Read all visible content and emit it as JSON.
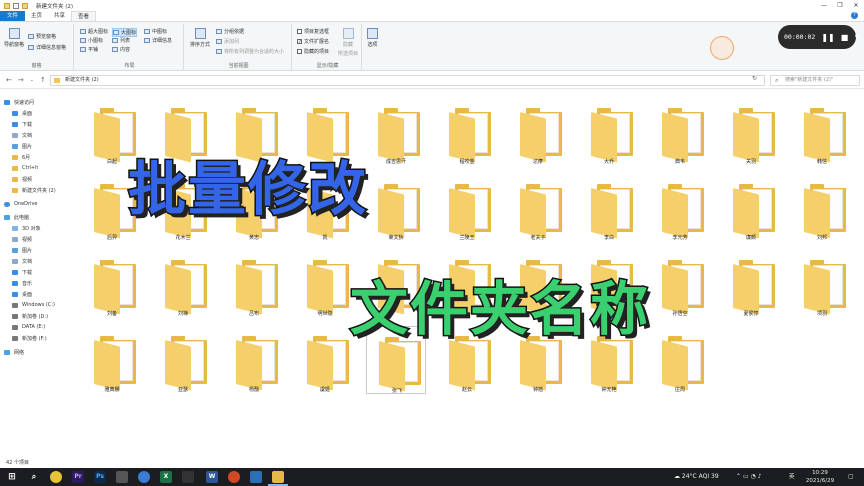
{
  "window": {
    "title": "新建文件夹 (2)",
    "controls": [
      "—",
      "❐",
      "✕"
    ]
  },
  "ribbon_tabs": [
    {
      "label": "文件"
    },
    {
      "label": "主页"
    },
    {
      "label": "共享"
    },
    {
      "label": "查看"
    }
  ],
  "ribbon": {
    "panes": {
      "nav_pane": "导航窗格",
      "preview": "预览窗格",
      "details": "详细信息窗格",
      "group": "窗格"
    },
    "layout": {
      "items": [
        "超大图标",
        "大图标",
        "中图标",
        "小图标",
        "列表",
        "详细信息",
        "平铺",
        "内容"
      ],
      "group": "布局"
    },
    "current_view": {
      "sort": "排序方式",
      "group_by": "分组依据",
      "add_columns": "添加列",
      "size_columns": "将所有列调整为合适的大小",
      "group": "当前视图"
    },
    "show_hide": {
      "item_checkboxes": "项目复选框",
      "file_extensions": "文件扩展名",
      "hidden_items": "隐藏的项目",
      "hide_selected": "隐藏",
      "hide_selected2": "所选项目",
      "group": "显示/隐藏"
    },
    "options": "选项"
  },
  "recorder": {
    "time": "00:00:02"
  },
  "address": {
    "path": "新建文件夹 (2)",
    "search_placeholder": "搜索\"新建文件夹 (2)\""
  },
  "nav": {
    "quick_access": "快速访问",
    "items": [
      "桌面",
      "下载",
      "文档",
      "图片",
      "6月",
      "Ctrl+h",
      "视频",
      "新建文件夹 (2)"
    ],
    "onedrive": "OneDrive",
    "this_pc": "此电脑",
    "pc_items": [
      "3D 对象",
      "视频",
      "图片",
      "文档",
      "下载",
      "音乐",
      "桌面",
      "Windows (C:)",
      "DATA (E:)",
      "新加卷 (D:)",
      "新加卷 (F:)"
    ],
    "network": "网络"
  },
  "folders": [
    "白起",
    "",
    "",
    "",
    "成吉思汗",
    "程咬金",
    "达摩",
    "大乔",
    "典韦",
    "关羽",
    "韩信",
    "后羿",
    "花木兰",
    "黄忠",
    "凯",
    "莱文狄",
    "兰陵王",
    "老夫子",
    "李白",
    "李元芳",
    "廉颇",
    "刘邦",
    "刘备",
    "刘禅",
    "吕布",
    "明世隐",
    "",
    "",
    "",
    "",
    "孙悟空",
    "夏侯惇",
    "项羽",
    "雅典娜",
    "亚瑟",
    "杨戬",
    "虞姬",
    "张飞",
    "赵云",
    "钟馗",
    "钟无艳",
    "庄周"
  ],
  "overlay": {
    "line1": "批量修改",
    "line2": "文件夹名称"
  },
  "status": {
    "count": "42 个项目"
  },
  "taskbar": {
    "weather": "24°C  AQI 39",
    "time": "10:29",
    "date": "2021/6/29",
    "lang": "英"
  }
}
